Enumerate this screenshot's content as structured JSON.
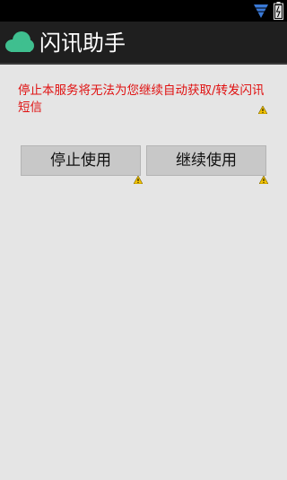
{
  "app": {
    "title": "闪讯助手"
  },
  "dialog": {
    "message": "停止本服务将无法为您继续自动获取/转发闪讯短信",
    "stop_label": "停止使用",
    "continue_label": "继续使用"
  },
  "colors": {
    "action_bar": "#1f1f1f",
    "message_text": "#e01212",
    "cloud_icon": "#3fbf8f",
    "wifi_icon": "#3a79d6",
    "button_bg": "#c8c8c8",
    "warning_icon": "#f2c200"
  },
  "icons": {
    "status_bar": [
      "wifi-icon",
      "battery-icon"
    ],
    "app": "cloud-icon",
    "hint": "warning-icon"
  }
}
